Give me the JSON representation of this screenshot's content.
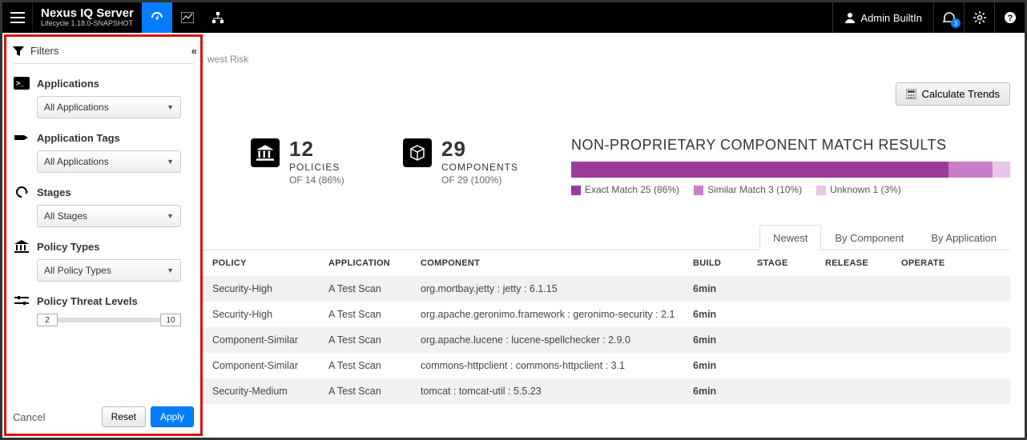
{
  "header": {
    "product": "Nexus IQ Server",
    "subtitle": "Lifecycle 1.18.0-SNAPSHOT",
    "user": "Admin BuiltIn",
    "notif_count": "3"
  },
  "sidebar": {
    "filters_label": "Filters",
    "applications": {
      "title": "Applications",
      "value": "All Applications"
    },
    "app_tags": {
      "title": "Application Tags",
      "value": "All Applications"
    },
    "stages": {
      "title": "Stages",
      "value": "All Stages"
    },
    "policy_types": {
      "title": "Policy Types",
      "value": "All Policy Types"
    },
    "threat": {
      "title": "Policy Threat Levels",
      "min": "2",
      "max": "10"
    },
    "cancel": "Cancel",
    "reset": "Reset",
    "apply": "Apply"
  },
  "main": {
    "breadcrumb_tail": "west Risk",
    "calc_trends": "Calculate Trends",
    "policies": {
      "count": "12",
      "label": "POLICIES",
      "sub": "OF 14 (86%)"
    },
    "components": {
      "count": "29",
      "label": "COMPONENTS",
      "sub": "OF 29 (100%)"
    },
    "match": {
      "title": "NON-PROPRIETARY COMPONENT MATCH RESULTS",
      "exact": "Exact Match 25 (86%)",
      "similar": "Similar Match 3 (10%)",
      "unknown": "Unknown 1 (3%)"
    },
    "tabs": {
      "newest": "Newest",
      "by_component": "By Component",
      "by_application": "By Application"
    },
    "columns": {
      "policy": "POLICY",
      "app": "APPLICATION",
      "comp": "COMPONENT",
      "build": "BUILD",
      "stage": "STAGE",
      "release": "RELEASE",
      "operate": "OPERATE"
    },
    "rows": [
      {
        "policy": "Security-High",
        "app": "A Test Scan",
        "comp": "org.mortbay.jetty : jetty : 6.1.15",
        "build": "6min"
      },
      {
        "policy": "Security-High",
        "app": "A Test Scan",
        "comp": "org.apache.geronimo.framework : geronimo-security : 2.1",
        "build": "6min"
      },
      {
        "policy": "Component-Similar",
        "app": "A Test Scan",
        "comp": "org.apache.lucene : lucene-spellchecker : 2.9.0",
        "build": "6min"
      },
      {
        "policy": "Component-Similar",
        "app": "A Test Scan",
        "comp": "commons-httpclient : commons-httpclient : 3.1",
        "build": "6min"
      },
      {
        "policy": "Security-Medium",
        "app": "A Test Scan",
        "comp": "tomcat : tomcat-util : 5.5.23",
        "build": "6min"
      }
    ]
  }
}
